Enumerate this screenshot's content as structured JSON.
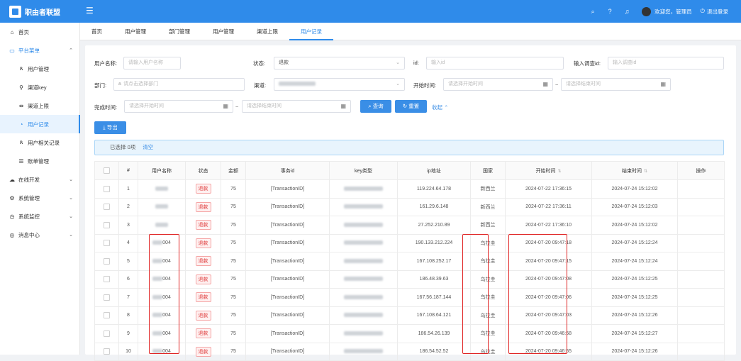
{
  "app": {
    "title": "职由者联盟",
    "welcome": "欢迎您，管理员",
    "logout": "退出登录"
  },
  "sidebar": {
    "items": [
      {
        "label": "首页",
        "icon": "home-icon"
      },
      {
        "label": "平台菜单",
        "icon": "monitor-icon"
      },
      {
        "label": "用户管理",
        "icon": "users-icon"
      },
      {
        "label": "渠道key",
        "icon": "key-icon"
      },
      {
        "label": "渠道上限",
        "icon": "limit-icon"
      },
      {
        "label": "用户记录",
        "icon": "record-icon"
      },
      {
        "label": "用户相关记录",
        "icon": "user-icon"
      },
      {
        "label": "账单管理",
        "icon": "bill-icon"
      },
      {
        "label": "在线开发",
        "icon": "cloud-icon"
      },
      {
        "label": "系统管理",
        "icon": "settings-icon"
      },
      {
        "label": "系统监控",
        "icon": "monitor-icon"
      },
      {
        "label": "消息中心",
        "icon": "message-icon"
      }
    ]
  },
  "tabs": [
    "首页",
    "用户管理",
    "部门管理",
    "用户管理",
    "渠道上限",
    "用户记录"
  ],
  "filters": {
    "username_label": "用户名称:",
    "username_placeholder": "请输入用户名称",
    "status_label": "状态:",
    "status_value": "退款",
    "id_label": "id:",
    "id_placeholder": "输入id",
    "tradeid_label": "输入调查id:",
    "tradeid_placeholder": "输入调查id",
    "dept_label": "部门:",
    "dept_placeholder": "请点击选择部门",
    "channel_label": "渠道:",
    "start_label": "开始时间:",
    "start_placeholder": "请选择开始时间",
    "end_placeholder": "请选择结束时间",
    "finish_label": "完成时间:",
    "finish_start_placeholder": "请选择开始时间",
    "finish_end_placeholder": "请选择结束时间",
    "tilde": "~"
  },
  "buttons": {
    "search": "查询",
    "reset": "重置",
    "collapse": "收起",
    "export": "导出"
  },
  "selection": {
    "text": "已选择 0项",
    "clear": "清空"
  },
  "table": {
    "headers": [
      "#",
      "用户名称",
      "状态",
      "金额",
      "事务id",
      "key类型",
      "ip地址",
      "国家",
      "开始时间",
      "结束时间",
      "操作"
    ],
    "rows": [
      {
        "no": "1",
        "user_suffix": "",
        "status": "退款",
        "amount": "75",
        "tx": "[TransactionID]",
        "ip": "119.224.64.178",
        "country": "新西兰",
        "start": "2024-07-22 17:36:15",
        "end": "2024-07-24 15:12:02"
      },
      {
        "no": "2",
        "user_suffix": "",
        "status": "退款",
        "amount": "75",
        "tx": "[TransactionID]",
        "ip": "161.29.6.148",
        "country": "新西兰",
        "start": "2024-07-22 17:36:11",
        "end": "2024-07-24 15:12:03"
      },
      {
        "no": "3",
        "user_suffix": "",
        "status": "退款",
        "amount": "75",
        "tx": "[TransactionID]",
        "ip": "27.252.210.89",
        "country": "新西兰",
        "start": "2024-07-22 17:36:10",
        "end": "2024-07-24 15:12:02"
      },
      {
        "no": "4",
        "user_suffix": "004",
        "status": "退款",
        "amount": "75",
        "tx": "[TransactionID]",
        "ip": "190.133.212.224",
        "country": "乌拉圭",
        "start": "2024-07-20 09:47:18",
        "end": "2024-07-24 15:12:24"
      },
      {
        "no": "5",
        "user_suffix": "004",
        "status": "退款",
        "amount": "75",
        "tx": "[TransactionID]",
        "ip": "167.108.252.17",
        "country": "乌拉圭",
        "start": "2024-07-20 09:47:15",
        "end": "2024-07-24 15:12:24"
      },
      {
        "no": "6",
        "user_suffix": "004",
        "status": "退款",
        "amount": "75",
        "tx": "[TransactionID]",
        "ip": "186.48.39.63",
        "country": "乌拉圭",
        "start": "2024-07-20 09:47:08",
        "end": "2024-07-24 15:12:25"
      },
      {
        "no": "7",
        "user_suffix": "004",
        "status": "退款",
        "amount": "75",
        "tx": "[TransactionID]",
        "ip": "167.56.187.144",
        "country": "乌拉圭",
        "start": "2024-07-20 09:47:06",
        "end": "2024-07-24 15:12:25"
      },
      {
        "no": "8",
        "user_suffix": "004",
        "status": "退款",
        "amount": "75",
        "tx": "[TransactionID]",
        "ip": "167.108.64.121",
        "country": "乌拉圭",
        "start": "2024-07-20 09:47:03",
        "end": "2024-07-24 15:12:26"
      },
      {
        "no": "9",
        "user_suffix": "004",
        "status": "退款",
        "amount": "75",
        "tx": "[TransactionID]",
        "ip": "186.54.26.139",
        "country": "乌拉圭",
        "start": "2024-07-20 09:46:58",
        "end": "2024-07-24 15:12:27"
      },
      {
        "no": "10",
        "user_suffix": "004",
        "status": "退款",
        "amount": "75",
        "tx": "[TransactionID]",
        "ip": "186.54.52.52",
        "country": "乌拉圭",
        "start": "2024-07-20 09:46:55",
        "end": "2024-07-24 15:12:26"
      }
    ]
  },
  "colors": {
    "primary": "#2f8bea",
    "highlight": "#e02424",
    "tag_red": "#e04040"
  }
}
